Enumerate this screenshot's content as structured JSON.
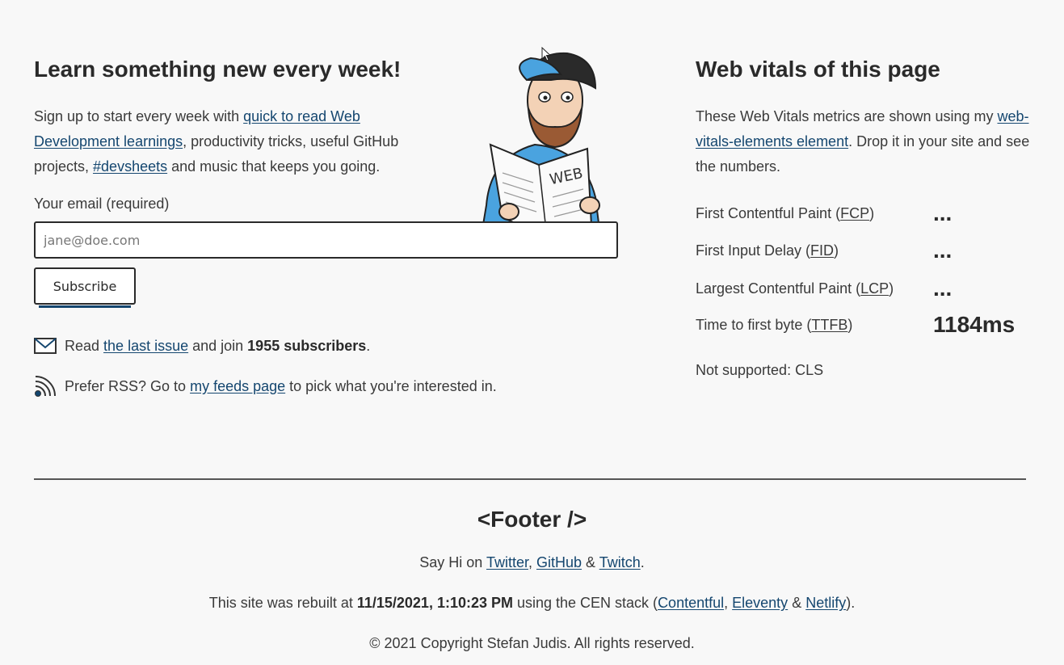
{
  "newsletter": {
    "title": "Learn something new every week!",
    "intro_before": "Sign up to start every week with ",
    "intro_link": "quick to read Web Development learnings",
    "intro_middle": ", productivity tricks, useful GitHub projects, ",
    "intro_link2": "#devsheets",
    "intro_after": " and music that keeps you going.",
    "email_label": "Your email (required)",
    "email_placeholder": "jane@doe.com",
    "subscribe_label": "Subscribe",
    "mail_line": {
      "before": "Read ",
      "link": "the last issue",
      "middle": " and join ",
      "count": "1955 subscribers",
      "after": "."
    },
    "rss_line": {
      "before": "Prefer RSS? Go to ",
      "link": "my feeds page",
      "after": " to pick what you're interested in."
    },
    "illustration_text": "WEB"
  },
  "vitals": {
    "title": "Web vitals of this page",
    "intro_before": "These Web Vitals metrics are shown using my ",
    "intro_link": "web-vitals-elements element",
    "intro_after": ". Drop it in your site and see the numbers.",
    "metrics": [
      {
        "label": "First Contentful Paint (",
        "abbr": "FCP",
        "close": ")",
        "value": "..."
      },
      {
        "label": "First Input Delay (",
        "abbr": "FID",
        "close": ")",
        "value": "..."
      },
      {
        "label": "Largest Contentful Paint (",
        "abbr": "LCP",
        "close": ")",
        "value": "..."
      },
      {
        "label": "Time to first byte (",
        "abbr": "TTFB",
        "close": ")",
        "value": "1184ms"
      }
    ],
    "not_supported": "Not supported: CLS"
  },
  "footer": {
    "title": "<Footer />",
    "say_hi": "Say Hi on ",
    "twitter": "Twitter",
    "comma": ", ",
    "github": "GitHub",
    "amp": " & ",
    "twitch": "Twitch",
    "period": ".",
    "rebuilt_before": "This site was rebuilt at ",
    "rebuilt_date": "11/15/2021, 1:10:23 PM",
    "rebuilt_middle": " using the CEN stack (",
    "contentful": "Contentful",
    "eleventy": "Eleventy",
    "netlify": "Netlify",
    "rebuilt_after": ").",
    "copyright": "© 2021 Copyright Stefan Judis. All rights reserved."
  },
  "colors": {
    "background": "#f8f8f8",
    "link": "#14466f",
    "text": "#3a3a3a"
  }
}
